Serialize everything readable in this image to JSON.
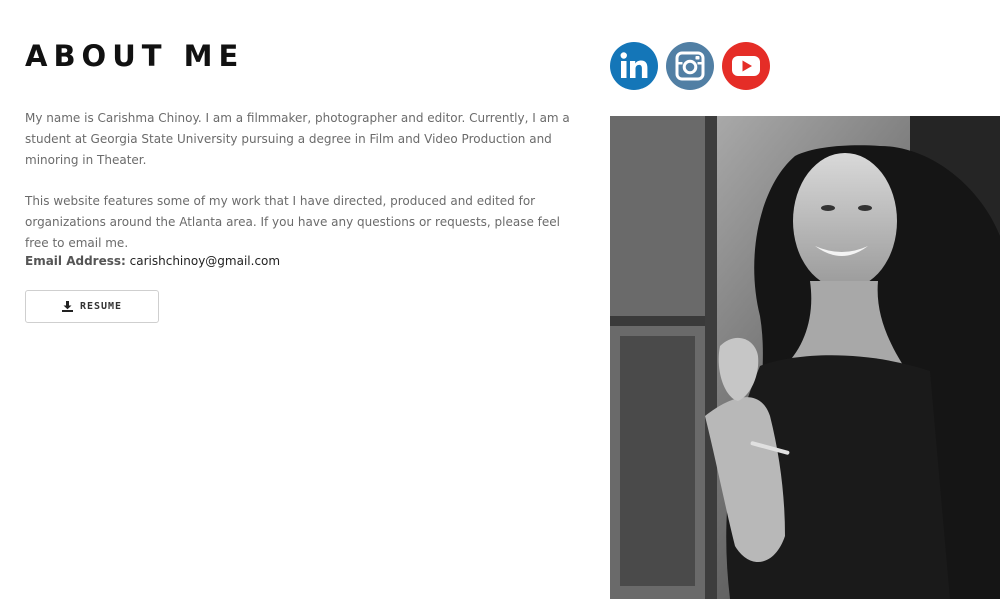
{
  "header": {
    "title": "ABOUT ME"
  },
  "about": {
    "paragraph_1": "My name is Carishma Chinoy. I am a filmmaker, photographer and editor. Currently, I am a student at Georgia State University pursuing a degree in Film and Video Production and minoring in Theater.",
    "paragraph_2": "This website features some of my work that I have directed, produced and edited for organizations around the Atlanta area. If you have any questions or requests, please feel free to email me.",
    "email_label": "Email Address:",
    "email_value": "carishchinoy@gmail.com"
  },
  "resume_button": {
    "label": "RESUME",
    "icon": "download-icon"
  },
  "social": [
    {
      "name": "linkedin",
      "icon": "linkedin-icon",
      "color": "#1476b8"
    },
    {
      "name": "instagram",
      "icon": "instagram-icon",
      "color": "#517fa4"
    },
    {
      "name": "youtube",
      "icon": "youtube-icon",
      "color": "#e52d27"
    }
  ],
  "photo": {
    "icon": "portrait-photo",
    "style": "black-and-white"
  }
}
